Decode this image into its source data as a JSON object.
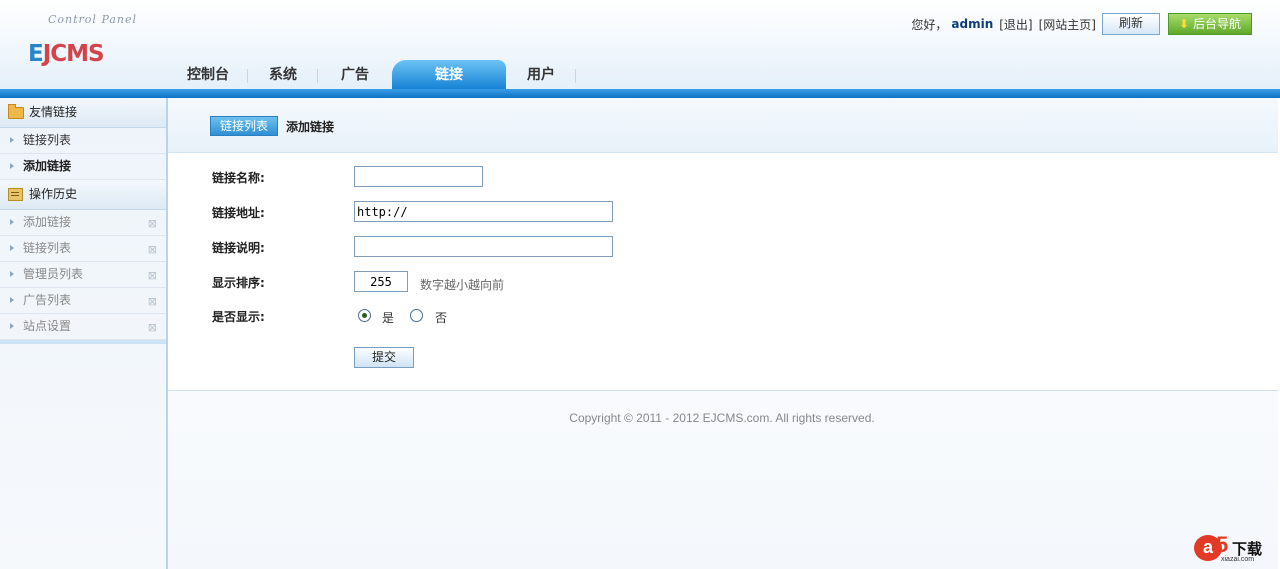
{
  "header": {
    "cp_text": "Control Panel",
    "logo": {
      "first": "E",
      "rest": "JCMS"
    },
    "greeting": "您好，",
    "username": "admin",
    "logout": "[退出]",
    "site_home": "[网站主页]",
    "refresh_label": "刷新",
    "nav_label": "后台导航",
    "colors": {
      "tab_active": "#1782d6",
      "strip": "#0e72c6",
      "nav_button": "#5ea82a"
    }
  },
  "tabs": [
    {
      "label": "控制台",
      "icon": ""
    },
    {
      "label": "系统"
    },
    {
      "label": "广告"
    },
    {
      "label": "链接",
      "active": true
    },
    {
      "label": "用户"
    }
  ],
  "sidebar": {
    "friend_links": {
      "title": "友情链接",
      "icon": "folder-icon",
      "items": [
        {
          "label": "链接列表"
        },
        {
          "label": "添加链接",
          "current": true
        }
      ]
    },
    "history": {
      "title": "操作历史",
      "icon": "history-icon",
      "items": [
        {
          "label": "添加链接",
          "close": "⊠"
        },
        {
          "label": "链接列表",
          "close": "⊠"
        },
        {
          "label": "管理员列表",
          "close": "⊠"
        },
        {
          "label": "广告列表",
          "close": "⊠"
        },
        {
          "label": "站点设置",
          "close": "⊠"
        }
      ]
    }
  },
  "main": {
    "subnav": {
      "list_button": "链接列表",
      "current": "添加链接"
    },
    "form": {
      "name_label": "链接名称:",
      "name_value": "",
      "url_label": "链接地址:",
      "url_value": "http://",
      "desc_label": "链接说明:",
      "desc_value": "",
      "order_label": "显示排序:",
      "order_value": "255",
      "order_hint": "数字越小越向前",
      "show_label": "是否显示:",
      "show_yes": "是",
      "show_no": "否",
      "submit_label": "提交"
    },
    "copyright": "Copyright © 2011 - 2012 EJCMS.com. All rights reserved."
  },
  "watermark": {
    "a": "a",
    "five": "5",
    "text": "下载",
    "domain": "xiazai.com"
  }
}
